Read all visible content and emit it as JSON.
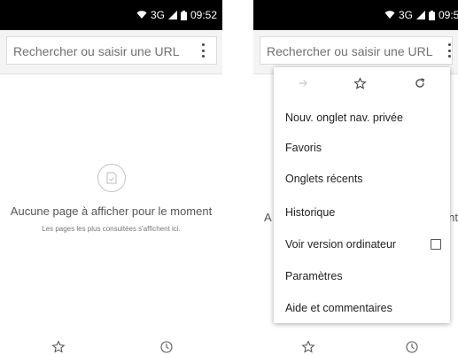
{
  "status": {
    "network": "3G",
    "time": "09:52"
  },
  "url_placeholder": "Rechercher ou saisir une URL",
  "empty_state": {
    "title": "Aucune page à afficher pour le moment",
    "subtitle": "Les pages les plus consultées s'affichent ici.",
    "title_left_fragment": "A",
    "title_right_fragment": "nt"
  },
  "menu": {
    "icons": [
      "forward-arrow-icon",
      "star-icon",
      "reload-icon"
    ],
    "items": [
      {
        "label": "Nouv. onglet nav. privée"
      },
      {
        "label": "Favoris"
      },
      {
        "label": "Onglets récents"
      },
      {
        "label": "Historique"
      },
      {
        "label": "Voir version ordinateur",
        "checkbox": false
      },
      {
        "label": "Paramètres"
      },
      {
        "label": "Aide et commentaires"
      }
    ]
  },
  "bottom_icons": [
    "star-icon",
    "history-clock-icon"
  ]
}
